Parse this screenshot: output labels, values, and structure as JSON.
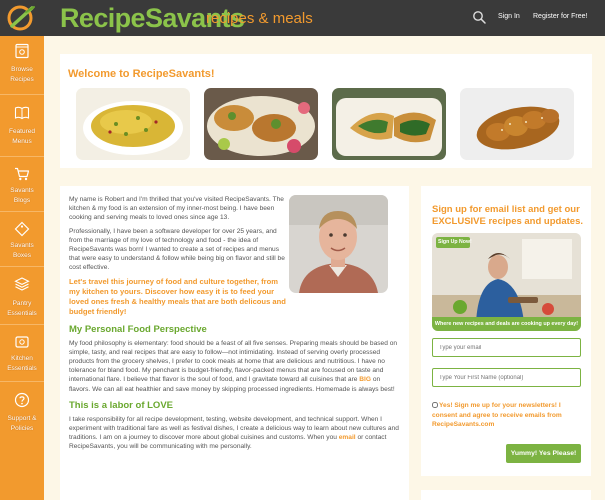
{
  "header": {
    "logo_main": "RecipeSavants",
    "logo_sub": "recipes & meals",
    "sign_in": "Sign In",
    "register": "Register for Free!",
    "colors": {
      "bar": "#3a3a3a",
      "brand_green": "#8bc34a",
      "brand_orange": "#f29a2e"
    }
  },
  "sidebar": {
    "items": [
      {
        "label": "Browse\nRecipes",
        "icon": "recipe-book-icon"
      },
      {
        "label": "Featured\nMenus",
        "icon": "menu-book-icon"
      },
      {
        "label": "Savants\nBlogs",
        "icon": "shopping-cart-icon"
      },
      {
        "label": "Savants\nBoxes",
        "icon": "tag-icon"
      },
      {
        "label": "Pantry\nEssentials",
        "icon": "layers-icon"
      },
      {
        "label": "Kitchen\nEssentials",
        "icon": "stove-icon"
      },
      {
        "label": "Support &\nPolicies",
        "icon": "help-icon"
      }
    ]
  },
  "welcome": {
    "title": "Welcome to RecipeSavants!",
    "photos": [
      "rice-pilaf-photo",
      "fish-tacos-photo",
      "spinach-pie-photo",
      "braided-bread-photo"
    ]
  },
  "bio": {
    "p1": "My name is Robert and I'm thrilled that you've visited RecipeSavants. The kitchen & my food is an extension of my inner-most being. I have been cooking and serving meals to loved ones since age 13.",
    "p2": "Professionally, I have been a software developer for over 25 years, and from the marriage of my love of technology and food - the idea of RecipeSavants was born! I wanted to create a set of recipes and menus that were easy to understand & follow while being big on flavor and still be cost effective.",
    "highlight": "Let's travel this journey of food and culture together, from my kitchen to yours. Discover how easy it is to feed your loved ones fresh & healthy meals that are both delicous and budget friendly!",
    "h1": "My Personal Food Perspective",
    "p3_before": "My food philosophy is elementary: food should be a feast of all five senses. Preparing meals should be based on simple, tasty, and real recipes that are easy to follow—not intimidating. Instead of serving overly processed products from the grocery shelves, I prefer to cook meals at home that are delicious and nutritious. I have no tolerance for bland food. My penchant is budget-friendly, flavor-packed menus that are focused on taste and international flare. I believe that flavor is the soul of food, and I gravitate toward all cuisines that are ",
    "p3_big": "BIG",
    "p3_after": " on flavors. We can all eat healthier and save money by skipping processed ingredients. Homemade is always best!",
    "h2": "This is a labor of LOVE",
    "p4_before": "I take responsibility for all recipe development, testing, website development, and technical support. When I experiment with traditional fare as well as festival dishes, I create a delicious way to learn about new cultures and traditions. I am on a journey to discover more about global cuisines and customs. When you ",
    "p4_link": "email",
    "p4_after": " or contact RecipeSavants, you will be communicating with me personally."
  },
  "newsletter": {
    "title": "Sign up for email list and get our EXCLUSIVE recipes and updates.",
    "promo_badge": "Sign Up Now!",
    "promo_caption": "Where new recipes and deals are cooking up every day!",
    "email_placeholder": "Type your email",
    "name_placeholder": "Type Your First Name (optional)",
    "consent": "Yes! Sign me up for your newsletters! I consent and agree to receive emails from RecipeSavants.com",
    "submit": "Yummy! Yes Please!"
  }
}
